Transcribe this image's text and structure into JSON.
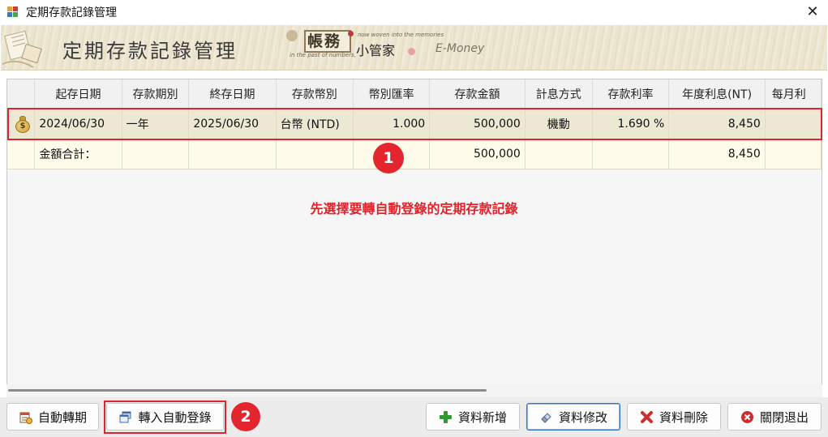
{
  "window": {
    "title": "定期存款記錄管理",
    "close_glyph": "✕"
  },
  "banner": {
    "title": "定期存款記錄管理",
    "brand_main": "帳務",
    "brand_sub": "小管家",
    "brand_en": "E-Money",
    "tagline_top": "now woven into the memories",
    "tagline_bottom": "in the past of numbers,"
  },
  "grid": {
    "columns": [
      "起存日期",
      "存款期別",
      "終存日期",
      "存款幣別",
      "幣別匯率",
      "存款金額",
      "計息方式",
      "存款利率",
      "年度利息(NT)",
      "每月利"
    ],
    "rows": [
      {
        "start": "2024/06/30",
        "term": "一年",
        "end": "2025/06/30",
        "currency": "台幣 (NTD)",
        "rate_fx": "1.000",
        "amount": "500,000",
        "interest_type": "機動",
        "interest_rate": "1.690 %",
        "annual_interest": "8,450",
        "monthly": ""
      }
    ],
    "total": {
      "label": "金額合計：",
      "amount": "500,000",
      "annual_interest": "8,450"
    }
  },
  "annotations": {
    "step1": "1",
    "step2": "2",
    "instruction": "先選擇要轉自動登錄的定期存款記錄"
  },
  "buttons": {
    "auto_rollover": "自動轉期",
    "transfer_auto": "轉入自動登錄",
    "add": "資料新增",
    "edit": "資料修改",
    "delete": "資料刪除",
    "close": "關閉退出"
  },
  "colors": {
    "accent_red": "#e0242c",
    "selected_row": "#ece8d3",
    "total_row": "#fffbea",
    "focus_blue": "#2f72c4"
  }
}
